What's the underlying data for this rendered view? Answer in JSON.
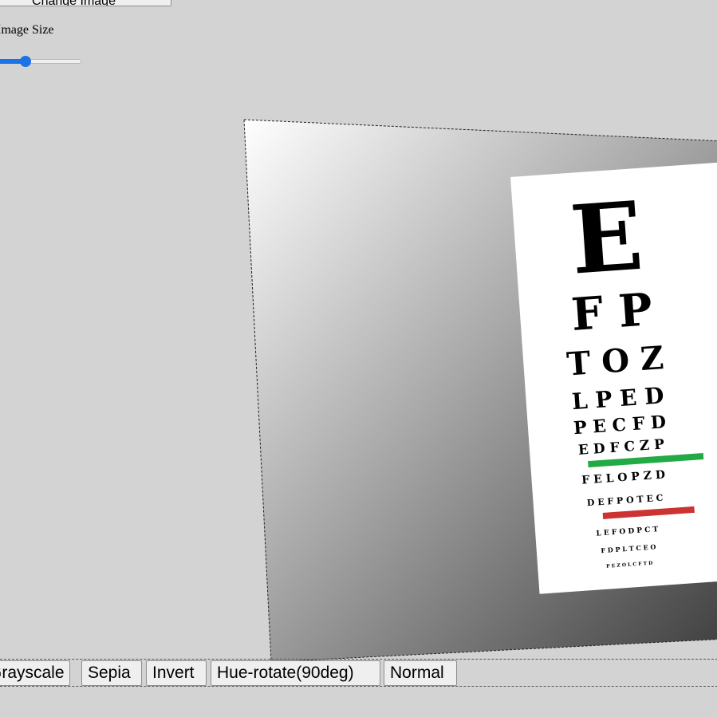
{
  "controls": {
    "top_button_label": "Change Image",
    "size_label": "Image Size",
    "size_slider_value_fraction": 0.35
  },
  "eye_chart": {
    "rows": [
      "E",
      "F P",
      "T O Z",
      "L P E D",
      "P E C F D",
      "E D F C Z P",
      "F E L O P Z D",
      "D E F P O T E C",
      "L E F O D P C T",
      "F D P L T C E O",
      "P E Z O L C F T D"
    ],
    "bar_colors": {
      "green": "#22aa44",
      "red": "#cc3333"
    }
  },
  "filters": {
    "buttons": [
      "Grayscale",
      "Sepia",
      "Invert",
      "Hue-rotate(90deg)",
      "Normal"
    ]
  },
  "colors": {
    "page_background": "#d3d3d3",
    "slider_accent": "#1a73e8",
    "button_background": "#efefef"
  }
}
